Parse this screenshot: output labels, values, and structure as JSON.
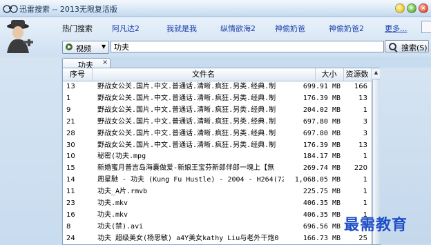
{
  "window": {
    "title": "迅雷搜索 -- 2013无限复活版"
  },
  "hot": {
    "label": "热门搜索",
    "links": [
      "阿凡达2",
      "我就是我",
      "纵情欲海2",
      "神偷奶爸",
      "神偷奶爸2"
    ],
    "more": "更多..."
  },
  "search": {
    "type": "视频",
    "query": "功夫",
    "button": "搜索(S)"
  },
  "tab": {
    "label": "功夫",
    "close": "×"
  },
  "table": {
    "headers": {
      "no": "序号",
      "name": "文件名",
      "size": "大小",
      "count": "资源数"
    },
    "rows": [
      {
        "no": "13",
        "name": "野战女公关.国片.中文.普通话.清晰.疯狂.另类.经典.制",
        "size": "699.91 MB",
        "count": "166"
      },
      {
        "no": "1",
        "name": "野战女公关.国片.中文.普通话.清晰.疯狂.另类.经典.制",
        "size": "176.39 MB",
        "count": "13"
      },
      {
        "no": "9",
        "name": "野战女公关.国片.中文.普通话.清晰.疯狂.另类.经典.制",
        "size": "204.02 MB",
        "count": "1"
      },
      {
        "no": "21",
        "name": "野战女公关.国片.中文.普通话.清晰.疯狂.另类.经典.制",
        "size": "697.80 MB",
        "count": "3"
      },
      {
        "no": "28",
        "name": "野战女公关.国片.中文.普通话.清晰.疯狂.另类.经典.制",
        "size": "697.80 MB",
        "count": "3"
      },
      {
        "no": "30",
        "name": "野战女公关.国片.中文.普通话.清晰.疯狂.另类.经典.制",
        "size": "176.39 MB",
        "count": "13"
      },
      {
        "no": "10",
        "name": "秘密(功夫.mpg",
        "size": "184.17 MB",
        "count": "1"
      },
      {
        "no": "15",
        "name": "新婚蜜月普吉岛海囊做爱-新娘王宝芬新郎伴郎一塊上【無",
        "size": "269.74 MB",
        "count": "220"
      },
      {
        "no": "14",
        "name": "周星馳 - 功夫 (Kung Fu Hustle) - 2004 - H264(720",
        "size": "1,068.05 MB",
        "count": "1"
      },
      {
        "no": "11",
        "name": "功夫_A片.rmvb",
        "size": "225.75 MB",
        "count": "1"
      },
      {
        "no": "23",
        "name": "功夫.mkv",
        "size": "406.35 MB",
        "count": "1"
      },
      {
        "no": "16",
        "name": "功夫.mkv",
        "size": "406.35 MB",
        "count": "1"
      },
      {
        "no": "8",
        "name": "功夫(禁).avi",
        "size": "696.56 MB",
        "count": "1"
      },
      {
        "no": "24",
        "name": "功夫 超级美女(杨思敏) a4Y美女kathy Liu与老外干炮0",
        "size": "166.73 MB",
        "count": "25"
      }
    ]
  },
  "watermark": "最需教育"
}
